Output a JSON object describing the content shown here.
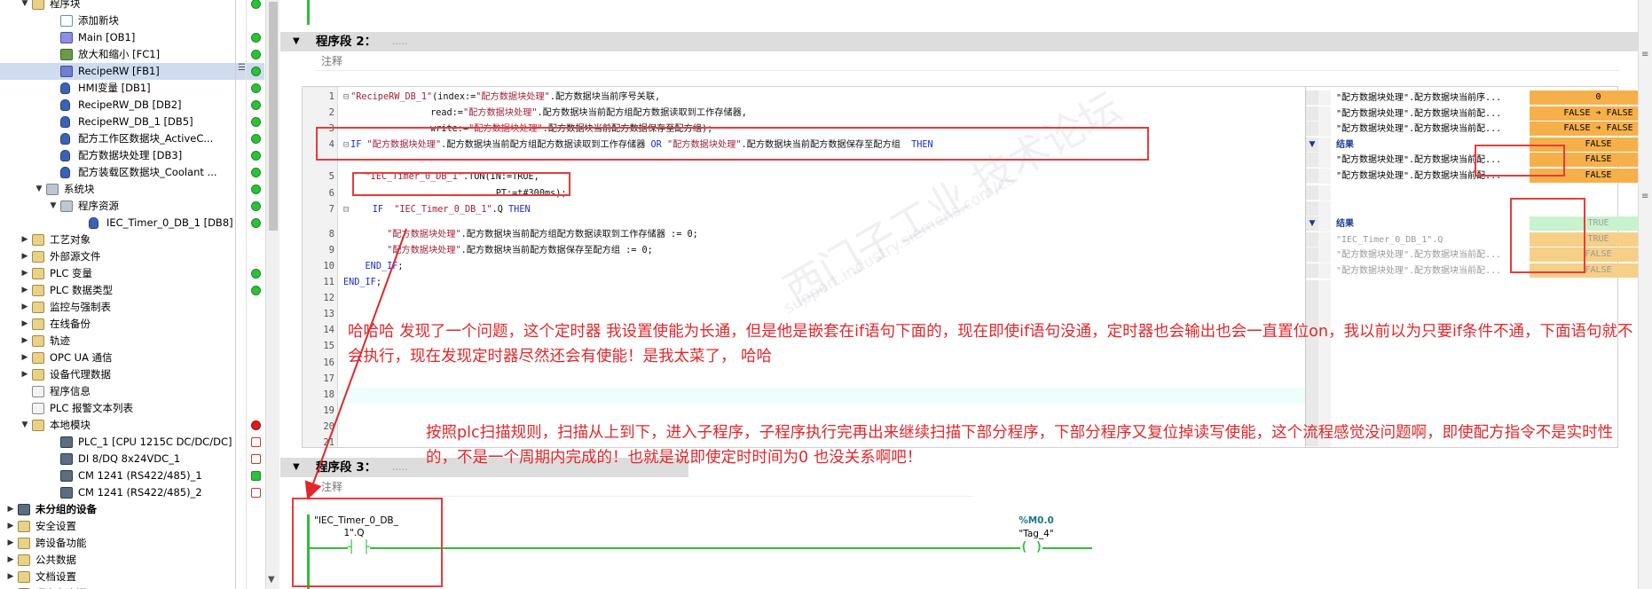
{
  "tree": {
    "rows": [
      {
        "label": "程序块",
        "indent": 2,
        "arrow": "▼",
        "icon": "folder",
        "status": "green"
      },
      {
        "label": "添加新块",
        "indent": 4,
        "icon": "add",
        "status": ""
      },
      {
        "label": "Main [OB1]",
        "indent": 4,
        "icon": "ob",
        "status": "green"
      },
      {
        "label": "放大和缩小 [FC1]",
        "indent": 4,
        "icon": "fc",
        "status": "green"
      },
      {
        "label": "RecipeRW [FB1]",
        "indent": 4,
        "icon": "fb",
        "status": "green",
        "selected": true
      },
      {
        "label": "HMI变量 [DB1]",
        "indent": 4,
        "icon": "db",
        "status": "green"
      },
      {
        "label": "RecipeRW_DB [DB2]",
        "indent": 4,
        "icon": "db",
        "status": "green"
      },
      {
        "label": "RecipeRW_DB_1 [DB5]",
        "indent": 4,
        "icon": "db",
        "status": "green"
      },
      {
        "label": "配方工作区数据块_ActiveC...",
        "indent": 4,
        "icon": "db",
        "status": "green"
      },
      {
        "label": "配方数据块处理 [DB3]",
        "indent": 4,
        "icon": "db",
        "status": "green"
      },
      {
        "label": "配方装载区数据块_Coolant ...",
        "indent": 4,
        "icon": "db",
        "status": "green"
      },
      {
        "label": "系统块",
        "indent": 3,
        "arrow": "▼",
        "icon": "sys",
        "status": "green"
      },
      {
        "label": "程序资源",
        "indent": 4,
        "arrow": "▼",
        "icon": "sys",
        "status": "green"
      },
      {
        "label": "IEC_Timer_0_DB_1 [DB8]",
        "indent": 6,
        "icon": "db",
        "status": "green"
      },
      {
        "label": "工艺对象",
        "indent": 2,
        "arrow": "▶",
        "icon": "folder",
        "status": ""
      },
      {
        "label": "外部源文件",
        "indent": 2,
        "arrow": "▶",
        "icon": "folder",
        "status": ""
      },
      {
        "label": "PLC 变量",
        "indent": 2,
        "arrow": "▶",
        "icon": "folder",
        "status": "green"
      },
      {
        "label": "PLC 数据类型",
        "indent": 2,
        "arrow": "▶",
        "icon": "folder",
        "status": "green"
      },
      {
        "label": "监控与强制表",
        "indent": 2,
        "arrow": "▶",
        "icon": "folder",
        "status": ""
      },
      {
        "label": "在线备份",
        "indent": 2,
        "arrow": "▶",
        "icon": "folder",
        "status": ""
      },
      {
        "label": "轨迹",
        "indent": 2,
        "arrow": "▶",
        "icon": "folder",
        "status": ""
      },
      {
        "label": "OPC UA 通信",
        "indent": 2,
        "arrow": "▶",
        "icon": "folder",
        "status": ""
      },
      {
        "label": "设备代理数据",
        "indent": 2,
        "arrow": "▶",
        "icon": "folder",
        "status": ""
      },
      {
        "label": "程序信息",
        "indent": 2,
        "icon": "doc",
        "status": ""
      },
      {
        "label": "PLC 报警文本列表",
        "indent": 2,
        "icon": "doc",
        "status": ""
      },
      {
        "label": "本地模块",
        "indent": 2,
        "arrow": "▼",
        "icon": "folder",
        "status": "red"
      },
      {
        "label": "PLC_1 [CPU 1215C DC/DC/DC]",
        "indent": 4,
        "icon": "dev",
        "status": "warn"
      },
      {
        "label": "DI 8/DQ 8x24VDC_1",
        "indent": 4,
        "icon": "dev",
        "status": "warn"
      },
      {
        "label": "CM 1241 (RS422/485)_1",
        "indent": 4,
        "icon": "dev",
        "status": "check"
      },
      {
        "label": "CM 1241 (RS422/485)_2",
        "indent": 4,
        "icon": "dev",
        "status": "warn"
      },
      {
        "label": "未分组的设备",
        "indent": 1,
        "arrow": "▶",
        "icon": "dev",
        "status": "",
        "bold": true
      },
      {
        "label": "安全设置",
        "indent": 1,
        "arrow": "▶",
        "icon": "folder",
        "status": ""
      },
      {
        "label": "跨设备功能",
        "indent": 1,
        "arrow": "▶",
        "icon": "folder",
        "status": ""
      },
      {
        "label": "公共数据",
        "indent": 1,
        "arrow": "▶",
        "icon": "folder",
        "status": ""
      },
      {
        "label": "文档设置",
        "indent": 1,
        "arrow": "▶",
        "icon": "folder",
        "status": ""
      },
      {
        "label": "语言和资源",
        "indent": 1,
        "arrow": "▶",
        "icon": "folder",
        "status": ""
      }
    ]
  },
  "editor": {
    "seg2": {
      "title": "程序段 2：",
      "comment_ph": ".....",
      "comment_label": "注释"
    },
    "seg3": {
      "title": "程序段 3：",
      "comment_ph": ".....",
      "comment_label": "注释"
    },
    "code_lines": [
      {
        "n": "1",
        "fold": "⊟",
        "indent": "",
        "parts": [
          [
            "str",
            "\"RecipeRW_DB_1\""
          ],
          [
            "",
            "(index:="
          ],
          [
            "str",
            "\"配方数据块处理\""
          ],
          [
            "",
            ".配方数据块当前序号关联,"
          ]
        ]
      },
      {
        "n": "2",
        "fold": "",
        "indent": "                ",
        "parts": [
          [
            "",
            "read:="
          ],
          [
            "str",
            "\"配方数据块处理\""
          ],
          [
            "",
            ".配方数据块当前配方组配方数据读取到工作存储器,"
          ]
        ]
      },
      {
        "n": "3",
        "fold": "",
        "indent": "                ",
        "parts": [
          [
            "",
            "write:="
          ],
          [
            "str",
            "\"配方数据块处理\""
          ],
          [
            "",
            ".配方数据块当前配方数据保存至配方组);"
          ]
        ]
      },
      {
        "n": "4",
        "fold": "⊟",
        "indent": "",
        "parts": [
          [
            "kw",
            "IF "
          ],
          [
            "str",
            "\"配方数据块处理\""
          ],
          [
            "",
            ".配方数据块当前配方组配方数据读取到工作存储器 "
          ],
          [
            "kw",
            "OR "
          ],
          [
            "str",
            "\"配方数据块处理\""
          ],
          [
            "",
            ".配方数据块当前配方数据保存至配方组  "
          ],
          [
            "kw",
            "THEN"
          ]
        ]
      },
      {
        "n": "5",
        "fold": "",
        "indent": "    ",
        "parts": [
          [
            "str",
            "\"IEC_Timer_0_DB_1\""
          ],
          [
            "",
            ".TON(IN:=TRUE,"
          ]
        ]
      },
      {
        "n": "6",
        "fold": "",
        "indent": "                            ",
        "parts": [
          [
            "",
            "PT:=t#300ms);"
          ]
        ]
      },
      {
        "n": "7",
        "fold": "⊟",
        "indent": "    ",
        "parts": [
          [
            "kw",
            "IF  "
          ],
          [
            "str",
            "\"IEC_Timer_0_DB_1\""
          ],
          [
            "",
            ".Q "
          ],
          [
            "kw",
            "THEN"
          ]
        ]
      },
      {
        "n": "8",
        "fold": "",
        "indent": "        ",
        "parts": [
          [
            "str",
            "\"配方数据块处理\""
          ],
          [
            "",
            ".配方数据块当前配方组配方数据读取到工作存储器 := 0;"
          ]
        ]
      },
      {
        "n": "9",
        "fold": "",
        "indent": "        ",
        "parts": [
          [
            "str",
            "\"配方数据块处理\""
          ],
          [
            "",
            ".配方数据块当前配方数据保存至配方组 := 0;"
          ]
        ]
      },
      {
        "n": "10",
        "fold": "",
        "indent": "    ",
        "parts": [
          [
            "kw",
            "END_IF"
          ],
          [
            "",
            ";"
          ]
        ]
      },
      {
        "n": "11",
        "fold": "",
        "indent": "",
        "parts": [
          [
            "kw",
            "END_IF"
          ],
          [
            "",
            ";"
          ]
        ]
      },
      {
        "n": "12",
        "fold": "",
        "indent": "",
        "parts": []
      },
      {
        "n": "13",
        "fold": "",
        "indent": "",
        "parts": []
      },
      {
        "n": "14",
        "fold": "",
        "indent": "",
        "parts": []
      },
      {
        "n": "15",
        "fold": "",
        "indent": "",
        "parts": []
      },
      {
        "n": "16",
        "fold": "",
        "indent": "",
        "parts": []
      },
      {
        "n": "17",
        "fold": "",
        "indent": "",
        "parts": []
      },
      {
        "n": "18",
        "fold": "",
        "indent": "",
        "parts": []
      },
      {
        "n": "19",
        "fold": "",
        "indent": "",
        "parts": []
      },
      {
        "n": "20",
        "fold": "",
        "indent": "",
        "parts": []
      },
      {
        "n": "21",
        "fold": "",
        "indent": "",
        "parts": []
      }
    ],
    "watch_rows": [
      {
        "name": "\"配方数据块处理\".配方数据块当前序...",
        "value": "0",
        "style": "orange"
      },
      {
        "name": "\"配方数据块处理\".配方数据块当前配...",
        "value": "FALSE ➔ FALSE",
        "style": "orange"
      },
      {
        "name": "\"配方数据块处理\".配方数据块当前配...",
        "value": "FALSE ➔ FALSE",
        "style": "orange"
      },
      {
        "name": "结果",
        "value": "FALSE",
        "style": "orange",
        "marker": "▼",
        "blue": true
      },
      {
        "name": "\"配方数据块处理\".配方数据块当前配...",
        "value": "FALSE",
        "style": "orange"
      },
      {
        "name": "\"配方数据块处理\".配方数据块当前配...",
        "value": "FALSE",
        "style": "orange"
      },
      {
        "name": "",
        "value": "",
        "style": ""
      },
      {
        "name": "",
        "value": "",
        "style": ""
      },
      {
        "name": "结果",
        "value": "TRUE",
        "style": "green",
        "marker": "▼",
        "blue": true
      },
      {
        "name": "\"IEC_Timer_0_DB_1\".Q",
        "value": "TRUE",
        "style": "pale",
        "grey": true
      },
      {
        "name": "\"配方数据块处理\".配方数据块当前配...",
        "value": "FALSE",
        "style": "pale",
        "grey": true
      },
      {
        "name": "\"配方数据块处理\".配方数据块当前配...",
        "value": "FALSE",
        "style": "pale",
        "grey": true
      }
    ],
    "lad": {
      "contact_operand": "\"IEC_Timer_0_DB_\n1\".Q",
      "contact_glyph": "┤ ├",
      "coil_address": "%M0.0",
      "coil_operand": "\"Tag_4\"",
      "coil_glyph": "( )"
    }
  },
  "annotations": {
    "note1": "哈哈哈  发现了一个问题，这个定时器 我设置使能为长通，但是他是嵌套在if语句下面的，现在即使if语句没通，定时器也会输出也会一直置位on，我以前以为只要if条件不通，下面语句就不会执行，现在发现定时器尽然还会有使能！是我太菜了， 哈哈",
    "note2": "按照plc扫描规则，扫描从上到下，进入子程序，子程序执行完再出来继续扫描下部分程序，下部分程序又复位掉读写使能，这个流程感觉没问题啊，即使配方指令不是实时性的，不是一个周期内完成的！也就是说即使定时时间为0  也没关系啊吧！",
    "color": "#e3262a"
  },
  "watermark": {
    "main": "西门子工业  技术论坛",
    "sub": "support.industry.siemens.com/cs"
  }
}
